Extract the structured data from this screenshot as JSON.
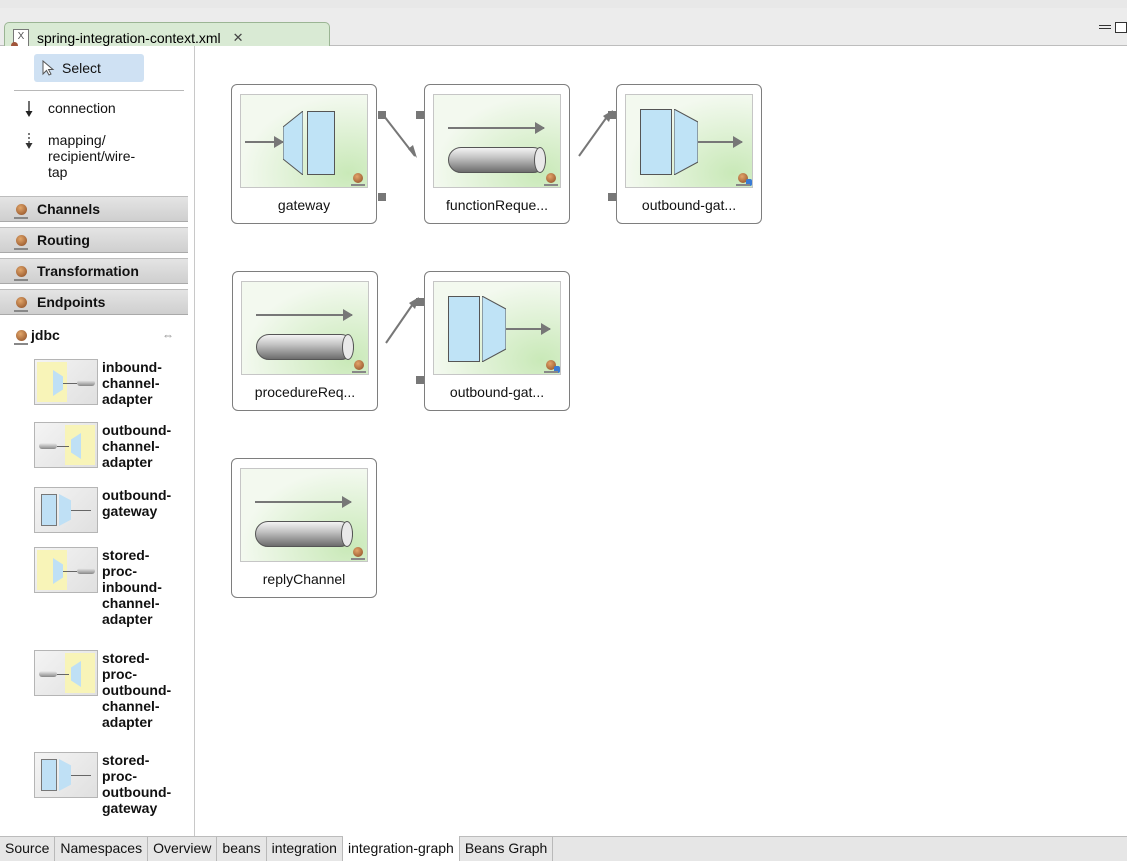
{
  "editor": {
    "tab_title": "spring-integration-context.xml",
    "tab_close": "✕"
  },
  "palette": {
    "select_label": "Select",
    "tools": [
      {
        "label": "connection",
        "icon": "solid-arrow-icon"
      },
      {
        "label": "mapping/\nrecipient/wire-\ntap",
        "icon": "dashed-arrow-icon"
      }
    ],
    "drawers": [
      "Channels",
      "Routing",
      "Transformation",
      "Endpoints"
    ],
    "open_drawer": "jdbc",
    "jdbc_items": [
      "inbound-\nchannel-\nadapter",
      "outbound-\nchannel-\nadapter",
      "outbound-\ngateway",
      "stored-\nproc-\ninbound-\nchannel-\nadapter",
      "stored-\nproc-\noutbound-\nchannel-\nadapter",
      "stored-\nproc-\noutbound-\ngateway"
    ]
  },
  "graph": {
    "nodes": [
      {
        "name": "gateway",
        "kind": "gateway"
      },
      {
        "name": "functionReque...",
        "kind": "channel"
      },
      {
        "name": "outbound-gat...",
        "kind": "outbound-gateway"
      },
      {
        "name": "procedureReq...",
        "kind": "channel"
      },
      {
        "name": "outbound-gat...",
        "kind": "outbound-gateway"
      },
      {
        "name": "replyChannel",
        "kind": "channel"
      }
    ]
  },
  "bottom_tabs": {
    "items": [
      "Source",
      "Namespaces",
      "Overview",
      "beans",
      "integration",
      "integration-graph",
      "Beans Graph"
    ],
    "active": "integration-graph"
  }
}
